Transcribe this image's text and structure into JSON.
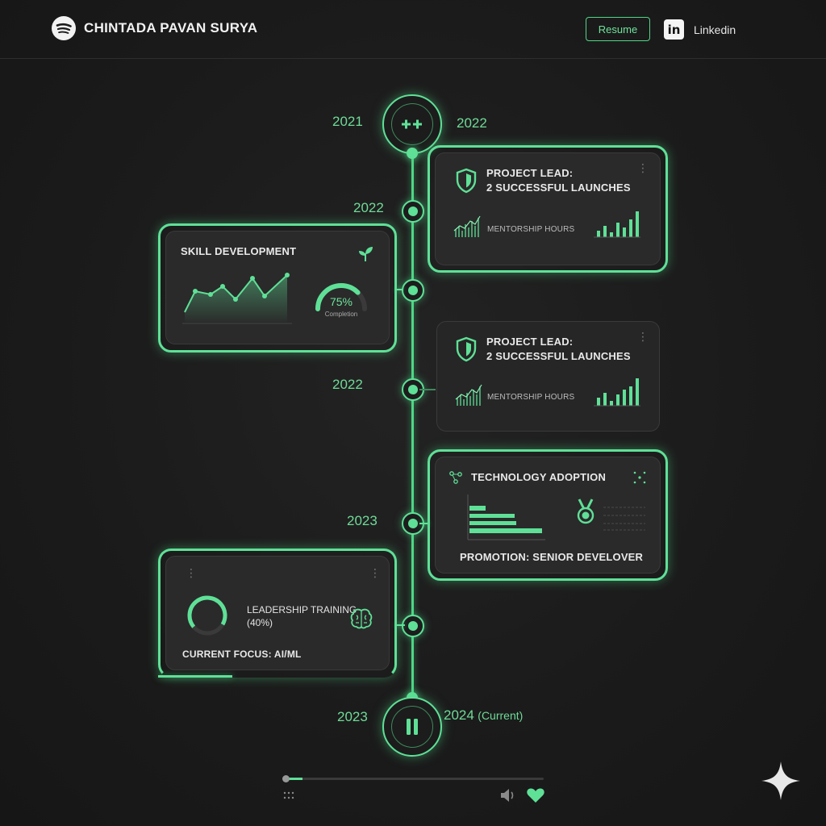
{
  "header": {
    "name": "CHINTADA PAVAN SURYA",
    "resume_label": "Resume",
    "linkedin_icon": "in",
    "linkedin_label": "Linkedin"
  },
  "timeline": {
    "top_year_left": "2021",
    "top_year_right": "2022",
    "years": [
      "2022",
      "2022",
      "2023"
    ],
    "bottom_year_left": "2023",
    "bottom_year_right": "2024",
    "bottom_year_right_note": "(Current)"
  },
  "cards": {
    "project_lead_1": {
      "title_line1": "PROJECT LEAD:",
      "title_line2": "2 SUCCESSFUL LAUNCHES",
      "metric_label": "MENTORSHIP HOURS",
      "icon": "shield-check-icon"
    },
    "skill_development": {
      "title": "SKILL DEVELOPMENT",
      "gauge_value": "75%",
      "gauge_label": "Completion",
      "gauge_fraction": 0.75,
      "icon": "sprout-icon"
    },
    "project_lead_2": {
      "title_line1": "PROJECT LEAD:",
      "title_line2": "2 SUCCESSFUL LAUNCHES",
      "metric_label": "MENTORSHIP HOURS",
      "icon": "shield-check-icon"
    },
    "technology_adoption": {
      "title": "TECHNOLOGY ADOPTION",
      "footer": "PROMOTION: SENIOR DEVELOVER",
      "icon": "medal-icon"
    },
    "leadership": {
      "title_line1": "LEADERSHIP TRAINING",
      "title_line2": "(40%)",
      "focus": "CURRENT FOCUS: AI/ML",
      "icon": "brain-icon"
    }
  },
  "player": {
    "progress_fraction": 0.07,
    "icons": [
      "grid-dots-icon",
      "volume-icon",
      "heart-icon",
      "sparkle-icon"
    ]
  },
  "colors": {
    "accent": "#5fe097",
    "background": "#1b1b1b",
    "card": "#2a2a2a"
  }
}
